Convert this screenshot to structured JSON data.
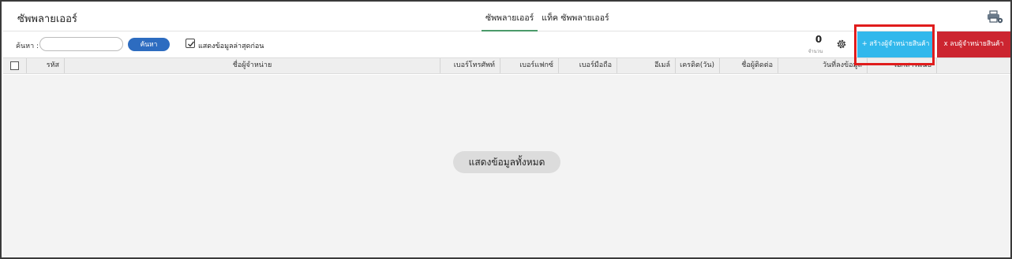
{
  "header": {
    "title": "ซัพพลายเออร์",
    "tabs": [
      {
        "label": "ซัพพลายเออร์",
        "active": true
      },
      {
        "label": "แท็ค ซัพพลายเออร์",
        "active": false
      }
    ],
    "print_icon": "printer-settings-icon"
  },
  "toolbar": {
    "search_label": "ค้นหา :",
    "search_value": "",
    "search_button": "ค้นหา",
    "latest_first_checked": true,
    "latest_first_label": "แสดงข้อมูลล่าสุดก่อน",
    "count_value": "0",
    "count_label": "จำนวน",
    "settings_icon": "gear-icon",
    "create_button": "+ สร้างผู้จำหน่ายสินค้า",
    "delete_button": "x ลบผู้จำหน่ายสินค้า"
  },
  "table": {
    "columns": [
      "รหัส",
      "ชื่อผู้จำหน่าย",
      "เบอร์โทรศัพท์",
      "เบอร์แฟกซ์",
      "เบอร์มือถือ",
      "อีเมล์",
      "เครดิต(วัน)",
      "ชื่อผู้ติดต่อ",
      "วันที่ลงข้อมูล",
      "เอกสารแนบ"
    ],
    "rows": []
  },
  "footer": {
    "show_all_button": "แสดงข้อมูลทั้งหมด"
  },
  "colors": {
    "search_button": "#2d6cc0",
    "create_button": "#31b8ec",
    "delete_button": "#cc2530",
    "active_tab_underline": "#4a9a6a",
    "highlight": "#e01c1c"
  }
}
